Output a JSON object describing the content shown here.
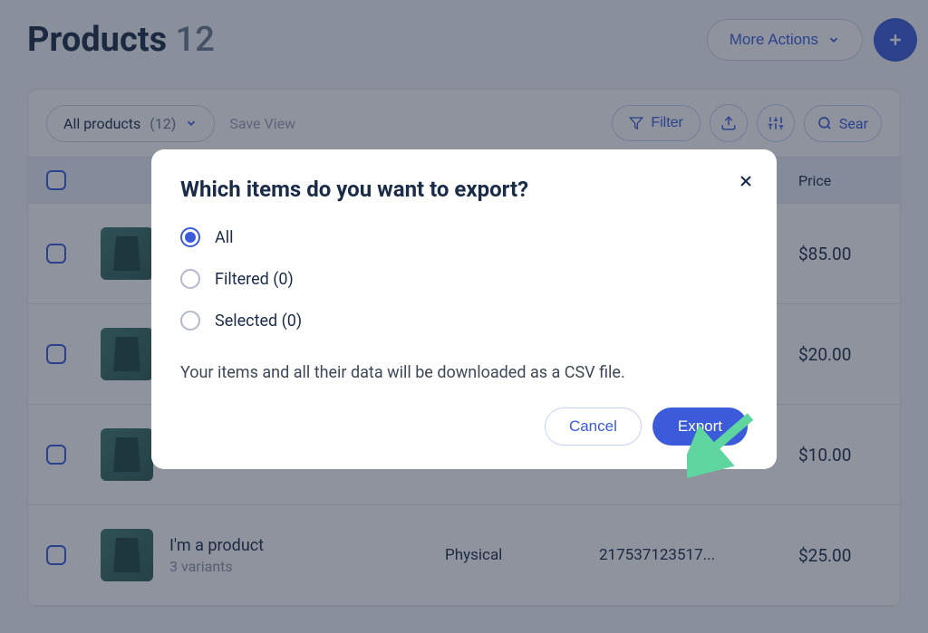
{
  "header": {
    "title": "Products",
    "count": "12",
    "more_actions": "More Actions"
  },
  "toolbar": {
    "all_products": "All products",
    "all_products_count": "(12)",
    "save_view": "Save View",
    "filter": "Filter",
    "search_placeholder": "Sear"
  },
  "columns": {
    "price": "Price"
  },
  "rows": [
    {
      "name": "",
      "variants": "",
      "type": "",
      "sku": "",
      "price": "$85.00"
    },
    {
      "name": "",
      "variants": "",
      "type": "",
      "sku": "",
      "price": "$20.00"
    },
    {
      "name": "",
      "variants": "",
      "type": "",
      "sku": "",
      "price": "$10.00"
    },
    {
      "name": "I'm a product",
      "variants": "3 variants",
      "type": "Physical",
      "sku": "217537123517...",
      "price": "$25.00"
    }
  ],
  "modal": {
    "title": "Which items do you want to export?",
    "options": {
      "all": "All",
      "filtered": "Filtered (0)",
      "selected": "Selected (0)"
    },
    "description": "Your items and all their data will be downloaded as a CSV file.",
    "cancel": "Cancel",
    "export": "Export"
  },
  "dots": "..."
}
